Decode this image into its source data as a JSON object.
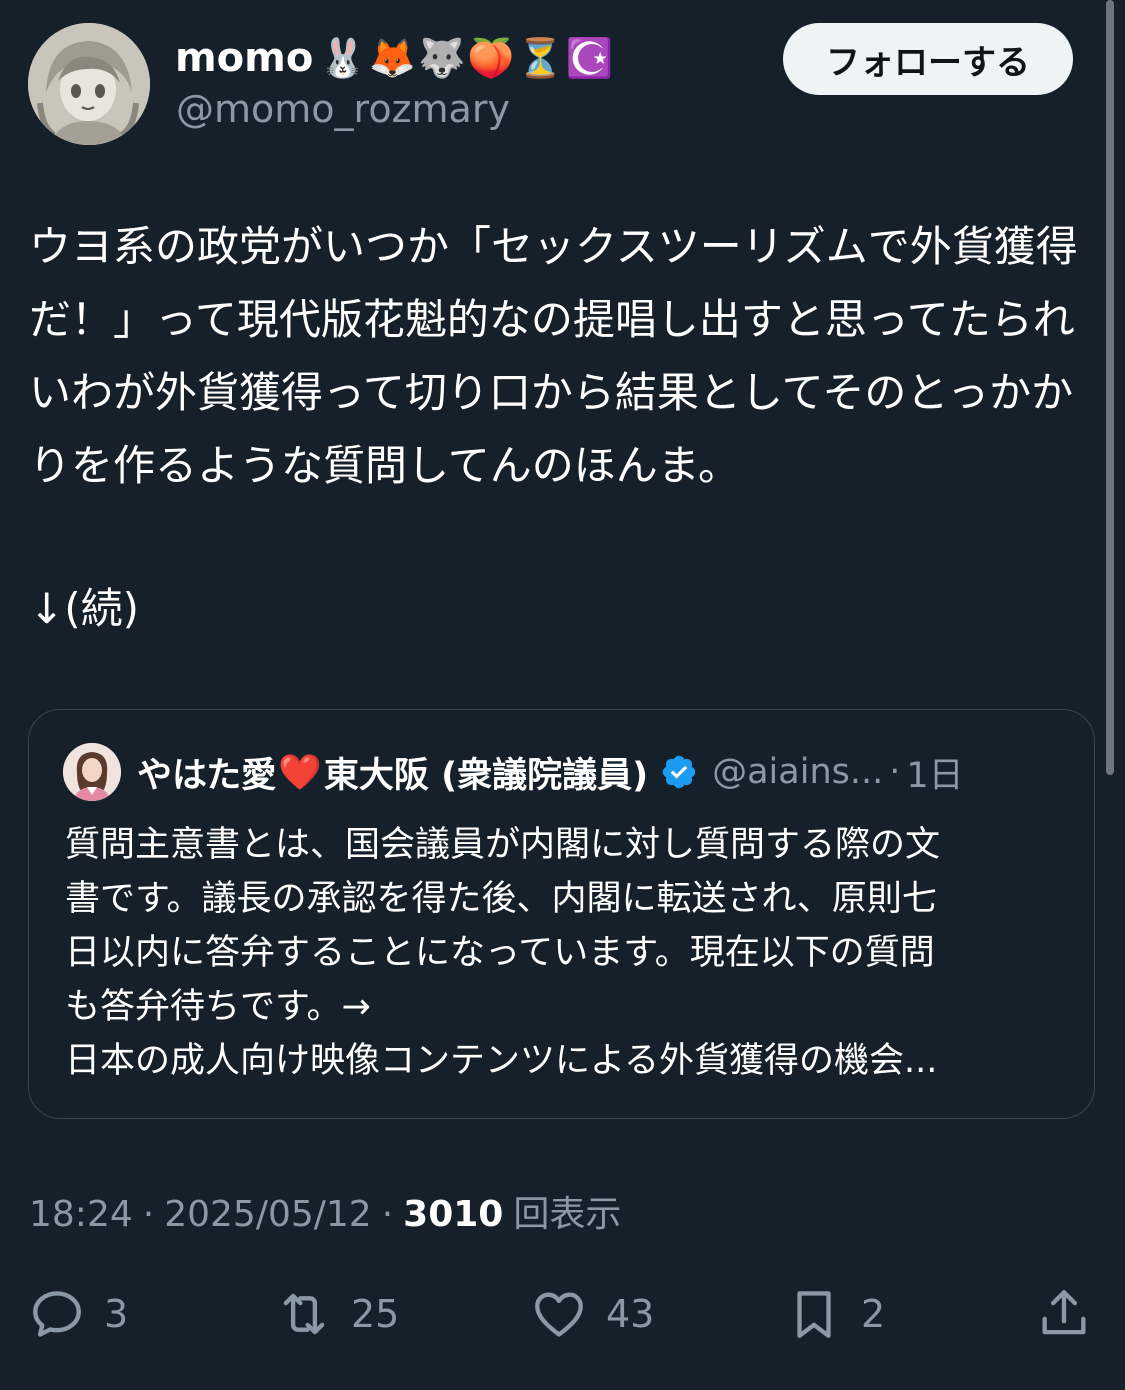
{
  "author": {
    "display_name": "momo",
    "name_emojis": "🐰🦊🐺🍑⏳☪️",
    "handle": "@momo_rozmary",
    "avatar_icon": "anime-girl-sketch-avatar"
  },
  "follow_button_label": "フォローする",
  "tweet": {
    "text": "ウヨ系の政党がいつか「セックスツーリズムで外貨獲得だ！」って現代版花魁的なの提唱し出すと思ってたられいわが外貨獲得って切り口から結果としてそのとっかかりを作るような質問してんのほんま。",
    "continue_text": "↓(続)"
  },
  "quote": {
    "display_name": "やはた愛",
    "heart": "❤️",
    "display_name_suffix": "東大阪 (衆議院議員)",
    "handle": "@aiains...",
    "separator": "·",
    "time": "1日",
    "lines": [
      "質問主意書とは、国会議員が内閣に対し質問する際の文",
      "書です。議長の承認を得た後、内閣に転送され、原則七",
      "日以内に答弁することになっています。現在以下の質問",
      "も答弁待ちです。→",
      "日本の成人向け映像コンテンツによる外貨獲得の機会..."
    ]
  },
  "meta": {
    "time": "18:24",
    "sep1": "·",
    "date": "2025/05/12",
    "sep2": "·",
    "views": "3010",
    "views_label": "回表示"
  },
  "actions": {
    "replies": "3",
    "retweets": "25",
    "likes": "43",
    "bookmarks": "2"
  },
  "colors": {
    "background": "#15202b",
    "secondary_text": "#8b98a5",
    "border": "#38444d",
    "verified": "#1d9bf0"
  }
}
